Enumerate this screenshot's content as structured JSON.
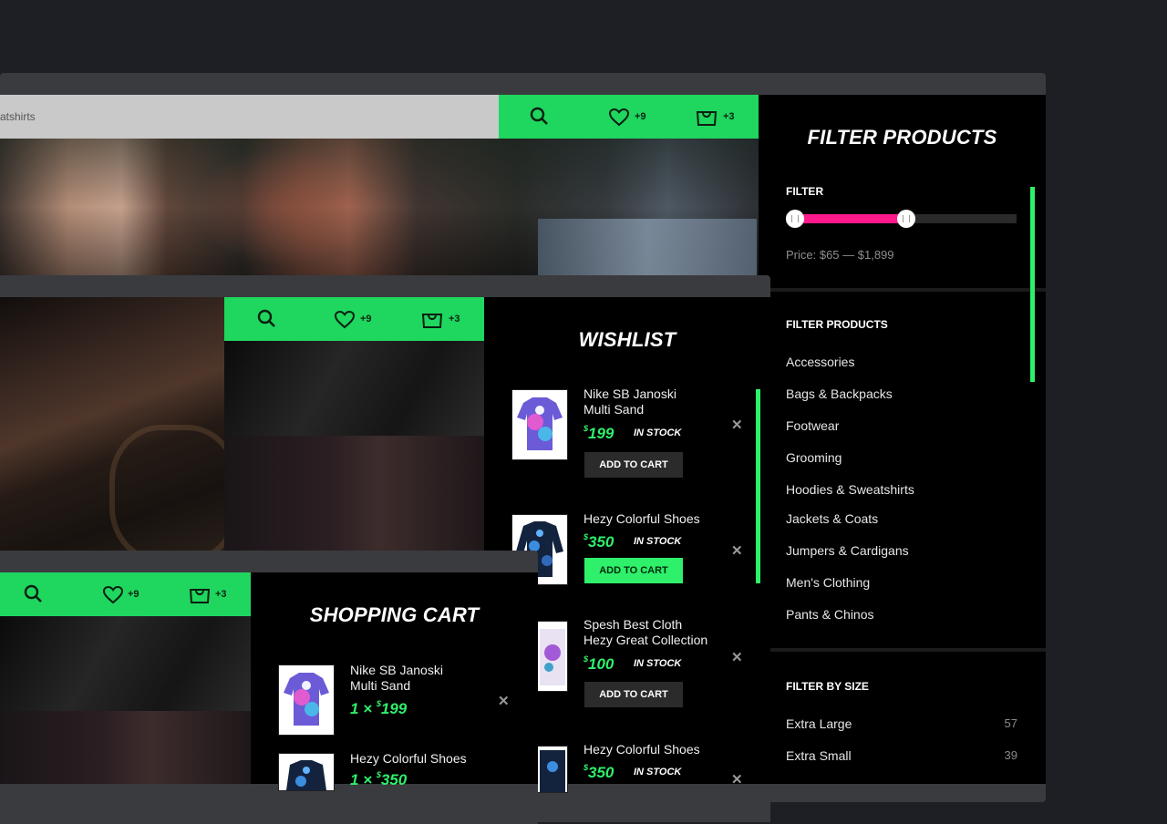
{
  "search": {
    "value_fragment": "atshirts"
  },
  "topbar": {
    "wishlist_count": "+9",
    "cart_count": "+3"
  },
  "midbar": {
    "wishlist_count": "+9",
    "cart_count": "+3"
  },
  "lowbar": {
    "wishlist_count": "+9",
    "cart_count": "+3"
  },
  "filter_panel": {
    "title": "FILTER PRODUCTS",
    "filter_label": "FILTER",
    "price_range": {
      "min": 65,
      "max": 1899,
      "low_fraction": 0.0,
      "high_fraction": 0.52
    },
    "price_text": "Price: $65 — $1,899",
    "categories_title": "FILTER PRODUCTS",
    "categories": [
      "Accessories",
      "Bags & Backpacks",
      "Footwear",
      "Grooming",
      "Hoodies & Sweatshirts",
      "Jackets & Coats",
      "Jumpers & Cardigans",
      "Men's Clothing",
      "Pants & Chinos"
    ],
    "size_title": "FILTER BY SIZE",
    "sizes": [
      {
        "label": "Extra Large",
        "count": "57"
      },
      {
        "label": "Extra Small",
        "count": "39"
      }
    ]
  },
  "wishlist": {
    "title": "WISHLIST",
    "items": [
      {
        "name_line1": "Nike SB Janoski",
        "name_line2": "Multi Sand",
        "currency": "$",
        "price": "199",
        "stock": "IN STOCK",
        "button": "ADD TO CART"
      },
      {
        "name_line1": "Hezy Colorful Shoes",
        "name_line2": "",
        "currency": "$",
        "price": "350",
        "stock": "IN STOCK",
        "button": "ADD TO CART"
      },
      {
        "name_line1": "Spesh Best Cloth",
        "name_line2": "Hezy Great Collection",
        "currency": "$",
        "price": "100",
        "stock": "IN STOCK",
        "button": "ADD TO CART"
      },
      {
        "name_line1": "Hezy Colorful Shoes",
        "name_line2": "",
        "currency": "$",
        "price": "350",
        "stock": "IN STOCK"
      }
    ]
  },
  "cart": {
    "title": "SHOPPING CART",
    "items": [
      {
        "name_line1": "Nike SB Janoski",
        "name_line2": "Multi Sand",
        "qty": "1 ×",
        "currency": "$",
        "price": "199"
      },
      {
        "name_line1": "Hezy Colorful Shoes",
        "qty": "1 ×",
        "currency": "$",
        "price": "350"
      }
    ]
  },
  "colors": {
    "accent_green": "#1fd65f",
    "bright_green": "#2ef06a",
    "slider_pink": "#ff1a8c",
    "panel_bg": "#000000",
    "page_bg": "#1e1f24"
  }
}
